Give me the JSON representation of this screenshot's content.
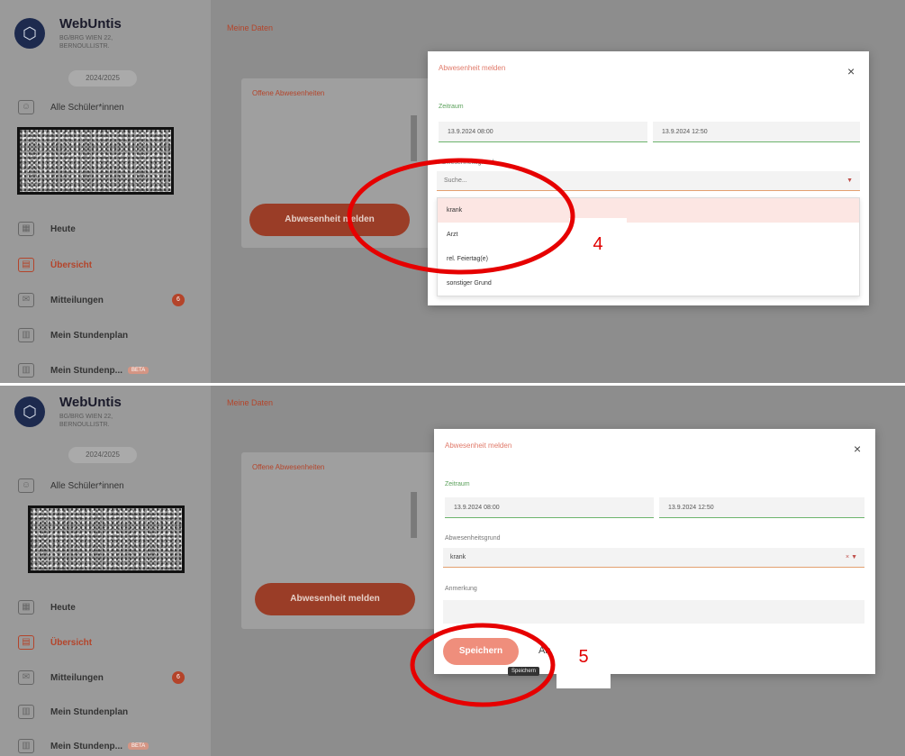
{
  "sidebar": {
    "brand": "WebUntis",
    "school": "BG/BRG WIEN 22, BERNOULLISTR.",
    "year": "2024/2025",
    "all_students": "Alle Schüler*innen",
    "items": [
      {
        "label": "Heute",
        "icon": "home-icon"
      },
      {
        "label": "Übersicht",
        "icon": "overview-icon",
        "active": true
      },
      {
        "label": "Mitteilungen",
        "icon": "mail-icon",
        "badge": "6"
      },
      {
        "label": "Mein Stundenplan",
        "icon": "calendar-icon"
      },
      {
        "label": "Mein Stundenp...",
        "icon": "calendar-icon",
        "tag": "BETA"
      }
    ]
  },
  "main": {
    "page_title": "Meine Daten",
    "card_title": "Offene Abwesenheiten",
    "report_button": "Abwesenheit melden"
  },
  "modal": {
    "title": "Abwesenheit melden",
    "close": "×",
    "period_label": "Zeitraum",
    "start": "13.9.2024 08:00",
    "end": "13.9.2024 12:50",
    "reason_label": "Abwesenheitsgrund",
    "search_placeholder": "Suche...",
    "reason_options": [
      "krank",
      "Arzt",
      "rel. Feiertag(e)",
      "sonstiger Grund"
    ],
    "selected_reason": "krank",
    "note_label": "Anmerkung",
    "save_button": "Speichern",
    "cancel_button": "Ab",
    "save_tooltip": "Speichern"
  },
  "annotations": {
    "step_4": "4",
    "step_5": "5",
    "circle_color": "#e60000"
  }
}
